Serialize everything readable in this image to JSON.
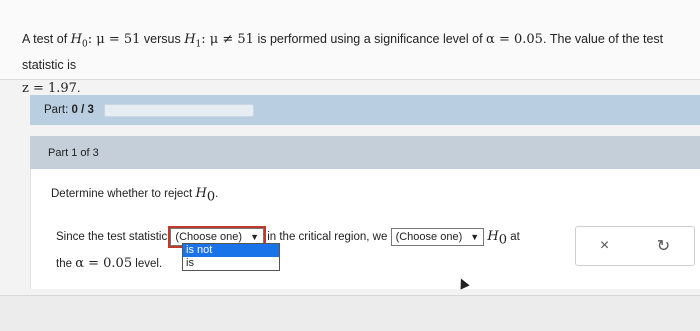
{
  "problem": {
    "intro": "A test of",
    "h0": "H",
    "h0_sub": "0",
    "h0_stmt": ": μ = 51",
    "versus": "versus",
    "h1": "H",
    "h1_sub": "1",
    "h1_stmt": ": μ ≠ 51",
    "mid": "is performed using a significance level of",
    "alpha": "α = 0.05",
    "tail": ". The value of the test statistic is",
    "z": "z = 1.97",
    "end": "."
  },
  "part": {
    "label": "Part:",
    "count": "0 / 3",
    "progress_fraction": 0
  },
  "subpart": {
    "label": "Part 1 of 3"
  },
  "question": {
    "title_prefix": "Determine whether to reject",
    "title_h": "H",
    "title_sub": "0",
    "title_end": ".",
    "s1": "Since the test statistic",
    "s2": "in the critical region, we",
    "s3_h": "H",
    "s3_sub": "0",
    "s3_end": "at",
    "s4": "the",
    "s4_alpha": "α = 0.05",
    "s4_end": "level."
  },
  "select1": {
    "value": "(Choose one)",
    "options": [
      "is not",
      "is"
    ],
    "highlighted": "is not"
  },
  "select2": {
    "value": "(Choose one)"
  },
  "actions": {
    "clear_icon": "×",
    "retry_icon": "↻"
  }
}
